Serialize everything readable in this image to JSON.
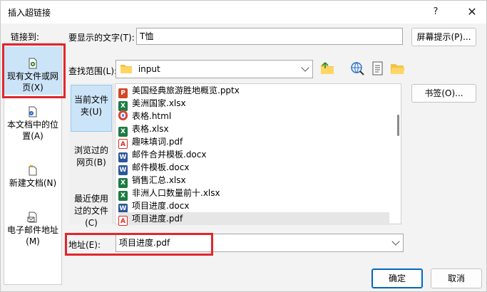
{
  "window": {
    "title": "插入超链接",
    "help_glyph": "?",
    "close_glyph": "✕"
  },
  "link_to": {
    "label": "链接到:",
    "items": [
      {
        "label": "现有文件或网页(X)",
        "icon": "existing-file-icon"
      },
      {
        "label": "本文档中的位置(A)",
        "icon": "document-place-icon"
      },
      {
        "label": "新建文档(N)",
        "icon": "new-document-icon"
      },
      {
        "label": "电子邮件地址(M)",
        "icon": "email-address-icon"
      }
    ]
  },
  "display_text": {
    "label": "要显示的文字(T):",
    "value": "T恤"
  },
  "screen_tip_button": "屏幕提示(P)...",
  "look_in": {
    "label": "查找范围(L):",
    "value": "input"
  },
  "bookmark_button": "书签(O)...",
  "sub_nav": [
    {
      "label": "当前文件夹(U)"
    },
    {
      "label": "浏览过的网页(B)"
    },
    {
      "label": "最近使用过的文件(C)"
    }
  ],
  "files": [
    {
      "name": "美国经典旅游胜地概览.pptx",
      "type": "pptx"
    },
    {
      "name": "美洲国家.xlsx",
      "type": "xlsx"
    },
    {
      "name": "表格.html",
      "type": "html"
    },
    {
      "name": "表格.xlsx",
      "type": "xlsx"
    },
    {
      "name": "趣味填词.pdf",
      "type": "pdf"
    },
    {
      "name": "邮件合并模板.docx",
      "type": "docx"
    },
    {
      "name": "邮件模板.docx",
      "type": "docx"
    },
    {
      "name": "销售汇总.xlsx",
      "type": "xlsx"
    },
    {
      "name": "非洲人口数量前十.xlsx",
      "type": "xlsx"
    },
    {
      "name": "项目进度.docx",
      "type": "docx"
    },
    {
      "name": "项目进度.pdf",
      "type": "pdf"
    }
  ],
  "address": {
    "label": "地址(E):",
    "value": "项目进度.pdf"
  },
  "ok_button": "确定",
  "cancel_button": "取消",
  "colors": {
    "accent": "#0067c0",
    "highlight": "#e0262b",
    "selection": "#cce4f7"
  }
}
